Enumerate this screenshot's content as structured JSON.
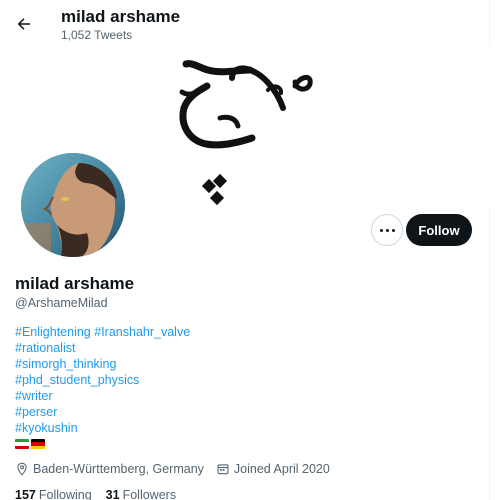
{
  "header": {
    "name": "milad arshame",
    "tweet_count": "1,052 Tweets",
    "back_icon": "arrow-left-icon"
  },
  "banner": {
    "calligraphy": "هیح",
    "logo_icon": "diamond-cluster-icon"
  },
  "profile": {
    "name": "milad arshame",
    "handle": "@ArshameMilad",
    "follow_label": "Follow",
    "more_icon": "more-horizontal-icon"
  },
  "bio": {
    "lines": [
      [
        "#Enlightening",
        "#Iranshahr_valve"
      ],
      [
        "#rationalist"
      ],
      [
        "#simorgh_thinking"
      ],
      [
        "#phd_student_physics"
      ],
      [
        "#writer"
      ],
      [
        "#perser"
      ],
      [
        "#kyokushin"
      ]
    ],
    "flags": [
      "iran-flag-icon",
      "germany-flag-icon"
    ]
  },
  "meta": {
    "location": "Baden-Württemberg, Germany",
    "location_icon": "location-pin-icon",
    "joined": "Joined April 2020",
    "joined_icon": "calendar-icon"
  },
  "stats": {
    "following_count": "157",
    "following_label": "Following",
    "followers_count": "31",
    "followers_label": "Followers"
  },
  "colors": {
    "link": "#1d9bf0",
    "text": "#0f1419",
    "secondary": "#536471",
    "button_dark": "#0f1419"
  }
}
